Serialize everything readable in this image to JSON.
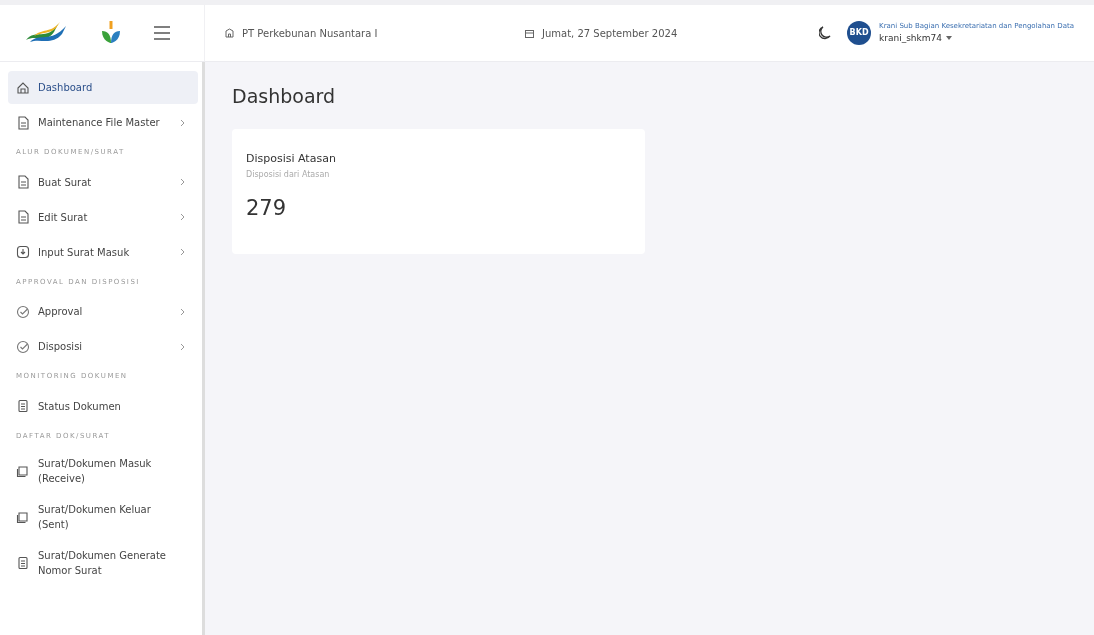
{
  "header": {
    "company": "PT Perkebunan Nusantara I",
    "date": "Jumat, 27 September 2024",
    "user_role": "Krani Sub Bagian Kesekretariatan dan Pengolahan Data",
    "username": "krani_shkm74",
    "avatar_text": "BKD"
  },
  "sidebar": {
    "items": [
      {
        "kind": "item",
        "label": "Dashboard",
        "selected": true,
        "has_arrow": false
      },
      {
        "kind": "item",
        "label": "Maintenance File Master",
        "selected": false,
        "has_arrow": true
      },
      {
        "kind": "section",
        "label": "ALUR DOKUMEN/SURAT"
      },
      {
        "kind": "item",
        "label": "Buat Surat",
        "selected": false,
        "has_arrow": true
      },
      {
        "kind": "item",
        "label": "Edit Surat",
        "selected": false,
        "has_arrow": true
      },
      {
        "kind": "item",
        "label": "Input Surat Masuk",
        "selected": false,
        "has_arrow": true
      },
      {
        "kind": "section",
        "label": "APPROVAL DAN DISPOSISI"
      },
      {
        "kind": "item",
        "label": "Approval",
        "selected": false,
        "has_arrow": true
      },
      {
        "kind": "item",
        "label": "Disposisi",
        "selected": false,
        "has_arrow": true
      },
      {
        "kind": "section",
        "label": "MONITORING DOKUMEN"
      },
      {
        "kind": "item",
        "label": "Status Dokumen",
        "selected": false,
        "has_arrow": false
      },
      {
        "kind": "section",
        "label": "DAFTAR DOK/SURAT"
      },
      {
        "kind": "item",
        "label": "Surat/Dokumen Masuk (Receive)",
        "selected": false,
        "has_arrow": false
      },
      {
        "kind": "item",
        "label": "Surat/Dokumen Keluar (Sent)",
        "selected": false,
        "has_arrow": false
      },
      {
        "kind": "item",
        "label": "Surat/Dokumen Generate Nomor Surat",
        "selected": false,
        "has_arrow": false
      }
    ]
  },
  "page_title": "Dashboard",
  "cards": [
    {
      "title": "Disposisi Atasan",
      "subtitle": "Disposisi dari Atasan",
      "value": "279"
    }
  ]
}
